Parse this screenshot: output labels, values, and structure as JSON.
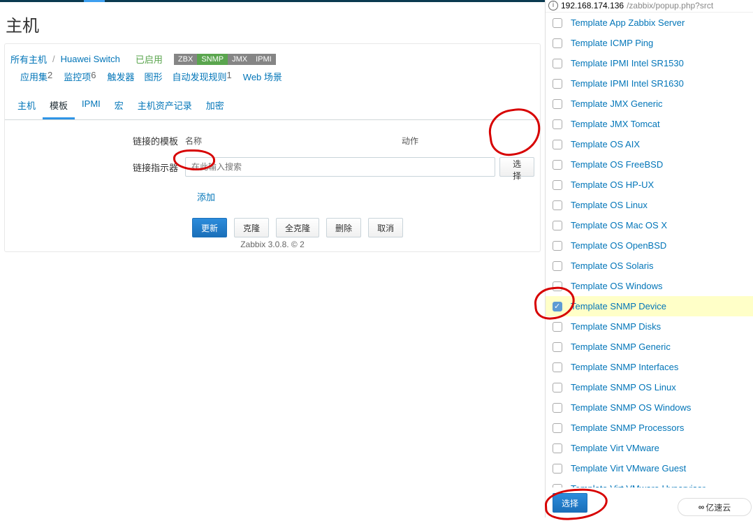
{
  "page": {
    "title": "主机"
  },
  "breadcrumb": {
    "all_hosts": "所有主机",
    "host": "Huawei Switch"
  },
  "status": {
    "enabled": "已启用"
  },
  "badges": {
    "zbx": "ZBX",
    "snmp": "SNMP",
    "jmx": "JMX",
    "ipmi": "IPMI"
  },
  "header_links": [
    {
      "label": "应用集",
      "count": "2"
    },
    {
      "label": "监控项",
      "count": "6"
    },
    {
      "label": "触发器",
      "count": ""
    },
    {
      "label": "图形",
      "count": ""
    },
    {
      "label": "自动发现规则",
      "count": "1"
    },
    {
      "label": "Web 场景",
      "count": ""
    }
  ],
  "tabs": [
    {
      "label": "主机"
    },
    {
      "label": "模板"
    },
    {
      "label": "IPMI"
    },
    {
      "label": "宏"
    },
    {
      "label": "主机资产记录"
    },
    {
      "label": "加密"
    }
  ],
  "active_tab": 1,
  "form": {
    "linked_templates_label": "链接的模板",
    "col_name": "名称",
    "col_action": "动作",
    "link_indicator_label": "链接指示器",
    "search_placeholder": "在此输入搜索",
    "select_btn": "选择",
    "add_link": "添加"
  },
  "buttons": {
    "update": "更新",
    "clone": "克隆",
    "full_clone": "全克隆",
    "delete": "删除",
    "cancel": "取消"
  },
  "footer": "Zabbix 3.0.8. © 2",
  "popup": {
    "url_host": "192.168.174.136",
    "url_path": "/zabbix/popup.php?srct",
    "select_btn": "选择",
    "templates": [
      {
        "name": "Template App Zabbix Server",
        "checked": false
      },
      {
        "name": "Template ICMP Ping",
        "checked": false
      },
      {
        "name": "Template IPMI Intel SR1530",
        "checked": false
      },
      {
        "name": "Template IPMI Intel SR1630",
        "checked": false
      },
      {
        "name": "Template JMX Generic",
        "checked": false
      },
      {
        "name": "Template JMX Tomcat",
        "checked": false
      },
      {
        "name": "Template OS AIX",
        "checked": false
      },
      {
        "name": "Template OS FreeBSD",
        "checked": false
      },
      {
        "name": "Template OS HP-UX",
        "checked": false
      },
      {
        "name": "Template OS Linux",
        "checked": false
      },
      {
        "name": "Template OS Mac OS X",
        "checked": false
      },
      {
        "name": "Template OS OpenBSD",
        "checked": false
      },
      {
        "name": "Template OS Solaris",
        "checked": false
      },
      {
        "name": "Template OS Windows",
        "checked": false
      },
      {
        "name": "Template SNMP Device",
        "checked": true
      },
      {
        "name": "Template SNMP Disks",
        "checked": false
      },
      {
        "name": "Template SNMP Generic",
        "checked": false
      },
      {
        "name": "Template SNMP Interfaces",
        "checked": false
      },
      {
        "name": "Template SNMP OS Linux",
        "checked": false
      },
      {
        "name": "Template SNMP OS Windows",
        "checked": false
      },
      {
        "name": "Template SNMP Processors",
        "checked": false
      },
      {
        "name": "Template Virt VMware",
        "checked": false
      },
      {
        "name": "Template Virt VMware Guest",
        "checked": false
      },
      {
        "name": "Template Virt VMware Hypervisor",
        "checked": false
      }
    ]
  },
  "watermark": "亿速云"
}
